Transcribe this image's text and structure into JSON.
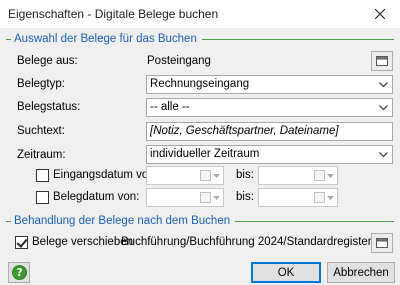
{
  "window": {
    "title": "Eigenschaften - Digitale Belege buchen",
    "close_icon": "close-icon"
  },
  "section_selection": {
    "title": "Auswahl der Belege für das Buchen",
    "belege_aus_label": "Belege aus:",
    "belege_aus_value": "Posteingang",
    "belegtyp_label": "Belegtyp:",
    "belegtyp_value": "Rechnungseingang",
    "belegstatus_label": "Belegstatus:",
    "belegstatus_value": "-- alle --",
    "suchtext_label": "Suchtext:",
    "suchtext_placeholder": "[Notiz, Geschäftspartner, Dateiname]",
    "zeitraum_label": "Zeitraum:",
    "zeitraum_value": "individueller Zeitraum",
    "eingangsdatum_label": "Eingangsdatum von:",
    "eingangsdatum_checked": false,
    "belegdatum_label": "Belegdatum von:",
    "belegdatum_checked": false,
    "bis_label": "bis:"
  },
  "section_handling": {
    "title": "Behandlung der Belege nach dem Buchen",
    "verschieben_label": "Belege verschieben",
    "verschieben_checked": true,
    "target_path": "Buchführung/Buchführung 2024/Standardregister"
  },
  "footer": {
    "ok_label": "OK",
    "cancel_label": "Abbrechen",
    "help_icon": "help-icon"
  },
  "colors": {
    "section_title": "#1a5fb4",
    "section_line": "#4aa14a",
    "default_button_border": "#0078d7"
  }
}
